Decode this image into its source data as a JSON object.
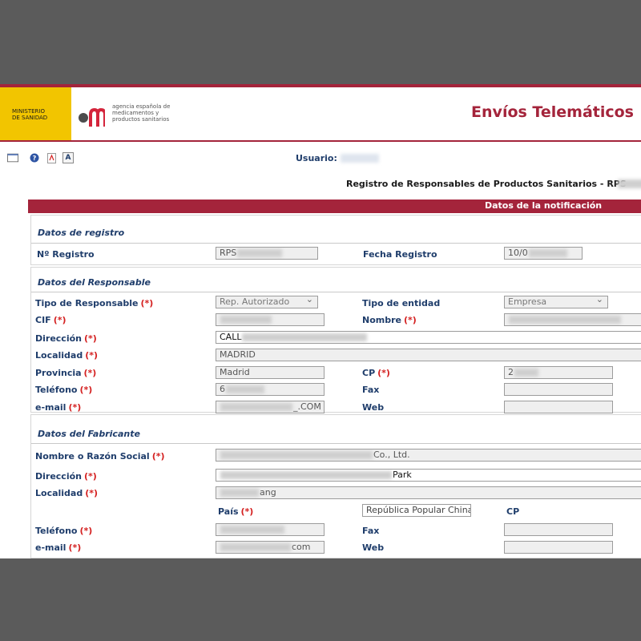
{
  "header": {
    "ministry_line1": "MINISTERIO",
    "ministry_line2": "DE SANIDAD",
    "agency_line1": "agencia española de",
    "agency_line2": "medicamentos y",
    "agency_line3": "productos sanitarios",
    "app_title": "Envíos Telemáticos"
  },
  "toolbar": {
    "icons": [
      "window-icon",
      "help-icon",
      "pdf-icon",
      "text-icon"
    ],
    "font_icon_label": "A",
    "user_label": "Usuario:"
  },
  "page": {
    "subtitle": "Registro de Responsables de Productos Sanitarios - RPS",
    "notification_title": "Datos de la notificación"
  },
  "registro": {
    "section_title": "Datos de registro",
    "numero_label": "Nº Registro",
    "numero_value": "RPS",
    "fecha_label": "Fecha Registro",
    "fecha_value": "10/0"
  },
  "responsable": {
    "section_title": "Datos del Responsable",
    "tipo_label": "Tipo de Responsable",
    "tipo_value": "Rep. Autorizado",
    "entidad_label": "Tipo de entidad",
    "entidad_value": "Empresa",
    "cif_label": "CIF",
    "nombre_label": "Nombre",
    "direccion_label": "Dirección",
    "direccion_value": "CALL",
    "localidad_label": "Localidad",
    "localidad_value": "MADRID",
    "provincia_label": "Provincia",
    "provincia_value": "Madrid",
    "cp_label": "CP",
    "cp_value": "2",
    "telefono_label": "Teléfono",
    "telefono_value": "6",
    "fax_label": "Fax",
    "email_label": "e-mail",
    "email_value": "_.COM",
    "web_label": "Web"
  },
  "fabricante": {
    "section_title": "Datos del Fabricante",
    "nombre_label": "Nombre o Razón Social",
    "nombre_value": "Co., Ltd.",
    "direccion_label": "Dirección",
    "direccion_value": "Park",
    "localidad_label": "Localidad",
    "localidad_value": "ang",
    "pais_label": "País",
    "pais_value": "República Popular China",
    "cp_label": "CP",
    "telefono_label": "Teléfono",
    "fax_label": "Fax",
    "email_label": "e-mail",
    "email_value": "com",
    "web_label": "Web"
  },
  "required_marker": "(*)",
  "colors": {
    "brand_red": "#a4243b",
    "label_blue": "#1f3d6b",
    "required_red": "#d42020",
    "ministry_yellow": "#f2c500"
  }
}
